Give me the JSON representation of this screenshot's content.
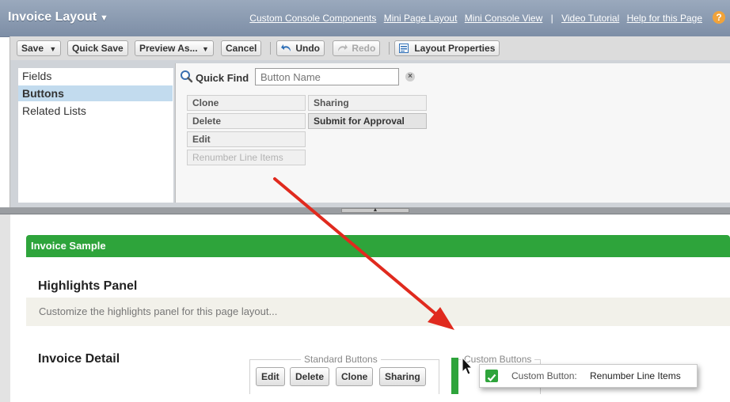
{
  "header": {
    "title": "Invoice Layout",
    "links": [
      "Custom Console Components",
      "Mini Page Layout",
      "Mini Console View",
      "Video Tutorial",
      "Help for this Page"
    ]
  },
  "toolbar": {
    "save": "Save",
    "quick_save": "Quick Save",
    "preview": "Preview As...",
    "cancel": "Cancel",
    "undo": "Undo",
    "redo": "Redo",
    "layout_properties": "Layout Properties"
  },
  "palette": {
    "categories": [
      "Fields",
      "Buttons",
      "Related Lists"
    ],
    "selected_category": "Buttons",
    "quick_find": {
      "label": "Quick Find",
      "placeholder": "Button Name"
    },
    "items_col1": [
      "Clone",
      "Delete",
      "Edit",
      "Renumber Line Items"
    ],
    "items_col2": [
      "Sharing",
      "Submit for Approval"
    ]
  },
  "layout": {
    "section_name": "Invoice Sample",
    "highlights_title": "Highlights Panel",
    "highlights_hint": "Customize the highlights panel for this page layout...",
    "detail_title": "Invoice Detail",
    "standard_buttons_legend": "Standard Buttons",
    "custom_buttons_legend": "Custom Buttons",
    "standard_buttons": [
      "Edit",
      "Delete",
      "Clone",
      "Sharing"
    ],
    "drag_item": {
      "prefix": "Custom Button:",
      "value": "Renumber Line Items"
    }
  },
  "colors": {
    "section_green": "#2ea43b",
    "arrow_red": "#e02a1e",
    "header_blue": "#8393ab"
  }
}
